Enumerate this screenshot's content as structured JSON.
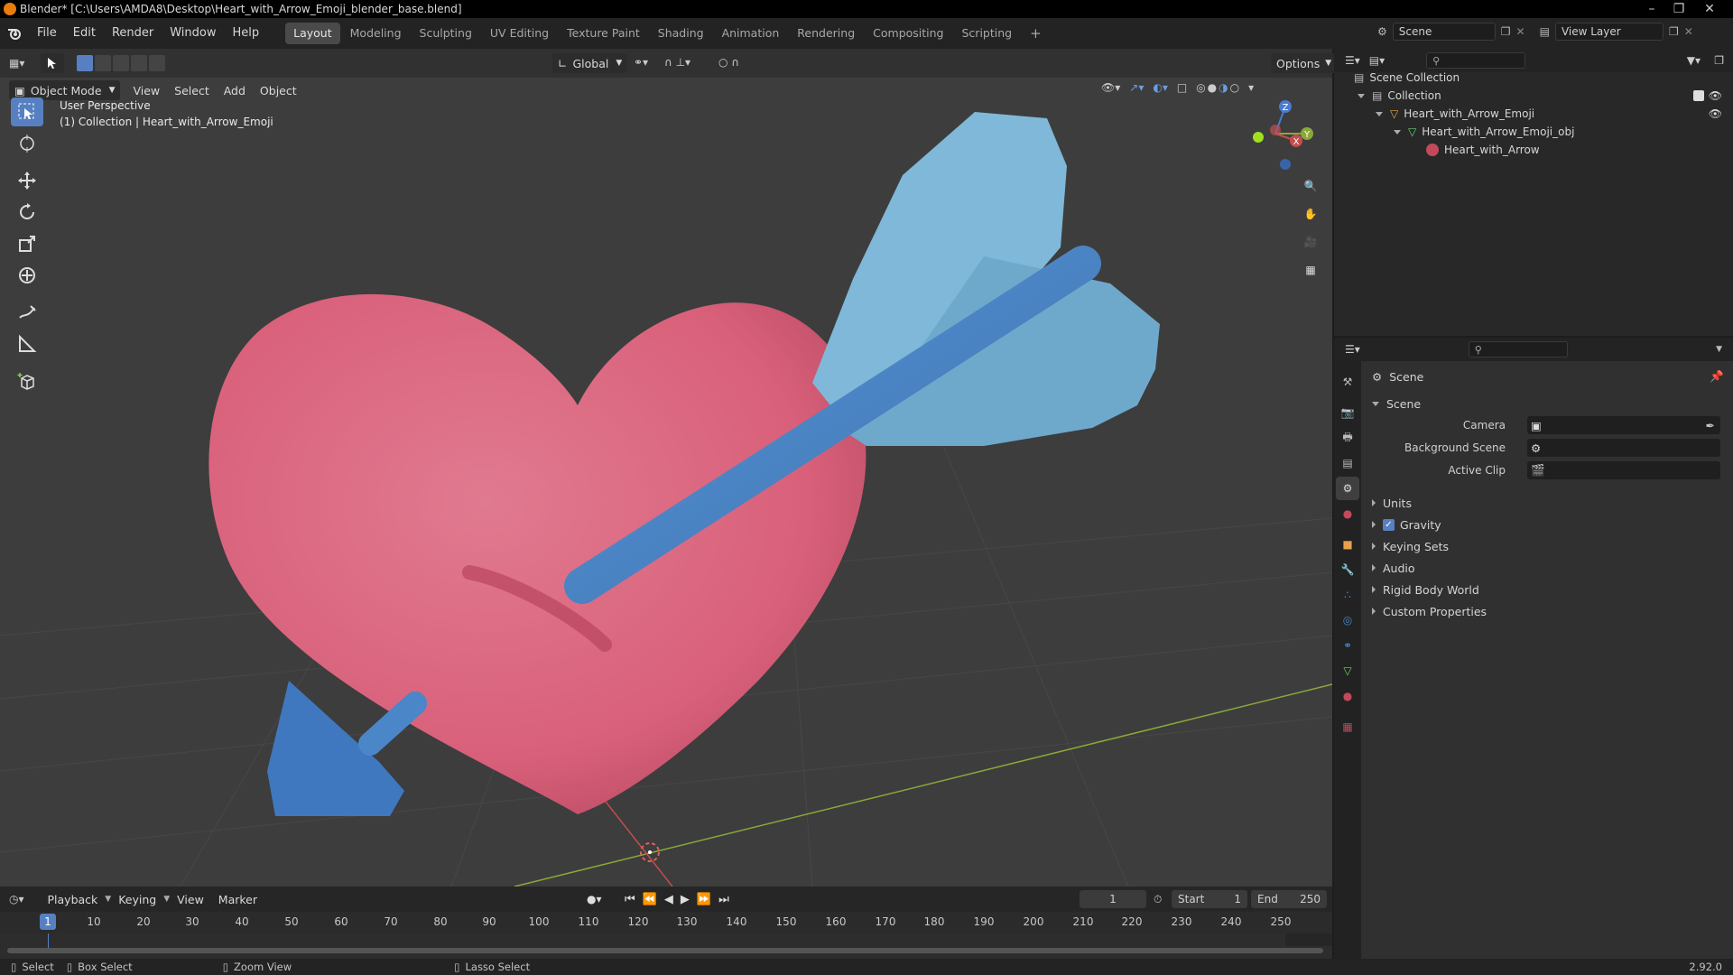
{
  "window": {
    "title": "Blender* [C:\\Users\\AMDA8\\Desktop\\Heart_with_Arrow_Emoji_blender_base.blend]"
  },
  "menubar": {
    "menus": [
      "File",
      "Edit",
      "Render",
      "Window",
      "Help"
    ],
    "workspaces": [
      "Layout",
      "Modeling",
      "Sculpting",
      "UV Editing",
      "Texture Paint",
      "Shading",
      "Animation",
      "Rendering",
      "Compositing",
      "Scripting"
    ],
    "active_workspace": "Layout",
    "add_tab": "+",
    "scene_name": "Scene",
    "view_layer": "View Layer"
  },
  "viewport": {
    "transform_orientation": "Global",
    "options_label": "Options",
    "mode": "Object Mode",
    "menus": [
      "View",
      "Select",
      "Add",
      "Object"
    ],
    "info_line1": "User Perspective",
    "info_line2": "(1) Collection | Heart_with_Arrow_Emoji",
    "gizmo_axes": [
      "Z",
      "Y",
      "X"
    ],
    "colors": {
      "heart": "#d9607a",
      "arrow_shaft": "#4a86c8",
      "fletching": "#7fb8d8",
      "background": "#3d3d3d",
      "x_axis": "#c44d4d",
      "y_axis": "#8aa83a",
      "z_axis": "#4a7bd0"
    }
  },
  "toolbar": {
    "tools": [
      "select-box-icon",
      "cursor-icon",
      "move-icon",
      "rotate-icon",
      "scale-icon",
      "transform-icon",
      "annotate-icon",
      "measure-icon",
      "add-cube-icon"
    ]
  },
  "timeline": {
    "menus": [
      "Playback",
      "Keying",
      "View",
      "Marker"
    ],
    "current_frame": "1",
    "start_label": "Start",
    "start": "1",
    "end_label": "End",
    "end": "250",
    "ruler": [
      "1",
      "10",
      "20",
      "30",
      "40",
      "50",
      "60",
      "70",
      "80",
      "90",
      "100",
      "110",
      "120",
      "130",
      "140",
      "150",
      "160",
      "170",
      "180",
      "190",
      "200",
      "210",
      "220",
      "230",
      "240",
      "250"
    ]
  },
  "statusbar": {
    "select": "Select",
    "box_select": "Box Select",
    "zoom_view": "Zoom View",
    "lasso_select": "Lasso Select",
    "version": "2.92.0"
  },
  "outliner": {
    "scene_collection": "Scene Collection",
    "collection": "Collection",
    "object": "Heart_with_Arrow_Emoji",
    "mesh": "Heart_with_Arrow_Emoji_obj",
    "material": "Heart_with_Arrow"
  },
  "properties": {
    "context": "Scene",
    "panel_title": "Scene",
    "camera_label": "Camera",
    "background_scene_label": "Background Scene",
    "active_clip_label": "Active Clip",
    "sections": [
      "Units",
      "Gravity",
      "Keying Sets",
      "Audio",
      "Rigid Body World",
      "Custom Properties"
    ],
    "gravity_checked": true
  }
}
